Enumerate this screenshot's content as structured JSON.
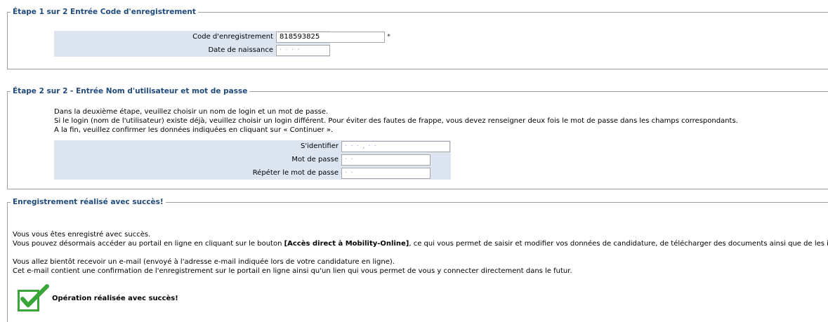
{
  "step1": {
    "legend": "Étape 1 sur 2 Entrée Code d'enregistrement",
    "code_label": "Code d'enregistrement",
    "code_value": "818593825",
    "required_mark": "*",
    "birth_label": "Date de naissance",
    "birth_value": "·  ·  ·  ·"
  },
  "step2": {
    "legend": "Étape 2 sur 2 - Entrée Nom d'utilisateur et mot de passe",
    "intro": [
      "Dans la deuxième étape, veuillez choisir un nom de login et un mot de passe.",
      "Si le login (nom de l'utilisateur) existe déjà, veuillez choisir un login différent. Pour éviter des fautes de frappe, vous devez renseigner deux fois le mot de passe dans les champs correspondants.",
      "A la fin, veuillez confirmer les données indiquées en cliquant sur « Continuer »."
    ],
    "login_label": "S'identifier",
    "login_value": "·  ·  ·  ,  ·  ·",
    "password_label": "Mot de passe",
    "password_value": "·  ·",
    "repeat_label": "Répéter le mot de passe",
    "repeat_value": "·  ·"
  },
  "success": {
    "legend": "Enregistrement réalisé avec succès!",
    "line1": "Vous vous êtes enregistré avec succès.",
    "line2_pre": "Vous pouvez désormais accéder au portail en ligne en cliquant sur le bouton ",
    "line2_bold": "[Accès direct à Mobility-Online]",
    "line2_post": ", ce qui vous permet de saisir et modifier vos données de candidature, de télécharger des documents ainsi que de les imprimer.",
    "line3": "Vous allez bientôt recevoir un e-mail (envoyé à l'adresse e-mail indiquée lors de votre candidature en ligne).",
    "line4": "Cet e-mail contient une confirmation de l'enregistrement sur le portail en ligne ainsi qu'un lien qui vous permet de vous y connecter directement dans le futur.",
    "confirm_text": "Opération réalisée avec succès!",
    "icon": "checkmark-icon",
    "icon_color": "#3aa63a"
  }
}
